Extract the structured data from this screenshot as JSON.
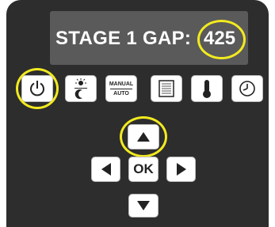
{
  "display": {
    "label": "STAGE 1 GAP:",
    "value": "425"
  },
  "buttons": {
    "power": {
      "icon": "power-icon"
    },
    "day_night": {
      "icon": "sun-moon-icon"
    },
    "manual_auto": {
      "top": "MANUAL",
      "bottom": "AUTO"
    },
    "menu": {
      "icon": "document-icon"
    },
    "temperature": {
      "icon": "thermometer-icon"
    },
    "clock": {
      "icon": "clock-icon"
    },
    "up": {
      "icon": "arrow-up-icon"
    },
    "left": {
      "icon": "arrow-left-icon"
    },
    "ok": {
      "label": "OK"
    },
    "right": {
      "icon": "arrow-right-icon"
    },
    "down": {
      "icon": "arrow-down-icon"
    }
  },
  "colors": {
    "panel": "#2d2d2d",
    "lcd": "#5a5a5a",
    "highlight": "#f2ea1f",
    "button": "#ffffff"
  }
}
